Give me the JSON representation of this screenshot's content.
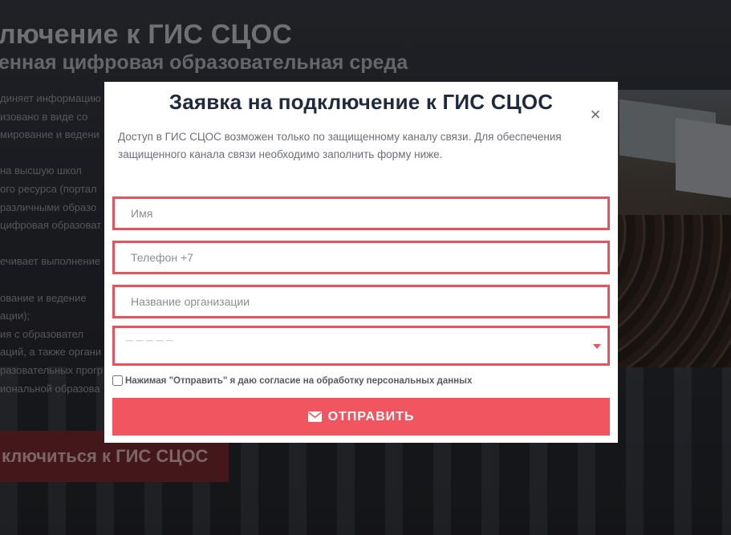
{
  "background": {
    "heading_line1": "лючение к ГИС СЦОС",
    "heading_line2": "енная цифровая образовательная среда",
    "paragraphs": [
      "диняет информацию",
      "изовано в виде со",
      "мирование и ведени",
      "",
      "на высшую школ",
      "ого ресурса (портал",
      "различными образо",
      "цифровая образоват",
      "",
      "ечивает выполнение",
      "",
      "ование и ведение",
      "ации);",
      "ия с образовател",
      "аций, а также органи",
      "разовательных прогр",
      "иональной образова"
    ],
    "cta_label": "ключиться к ГИС СЦОС"
  },
  "modal": {
    "title": "Заявка на подключение к ГИС СЦОС",
    "close_symbol": "×",
    "description": "Доступ в ГИС СЦОС возможен только по защищенному каналу связи. Для обеспечения защищенного канала связи необходимо заполнить форму ниже.",
    "fields": {
      "name_placeholder": "Имя",
      "phone_placeholder": "Телефон +7",
      "org_placeholder": "Название организации"
    },
    "select": {
      "selected_value": "— — — — —"
    },
    "consent_label": "Нажимая \"Отправить\" я даю согласие на обработку персональных данных",
    "submit_label": "ОТПРАВИТЬ"
  },
  "colors": {
    "accent": "#f15660",
    "field_border": "#e5535c",
    "title": "#1f2a3c"
  },
  "icons": {
    "submit": "envelope-icon",
    "close": "close-icon",
    "select": "chevron-down-icon"
  }
}
